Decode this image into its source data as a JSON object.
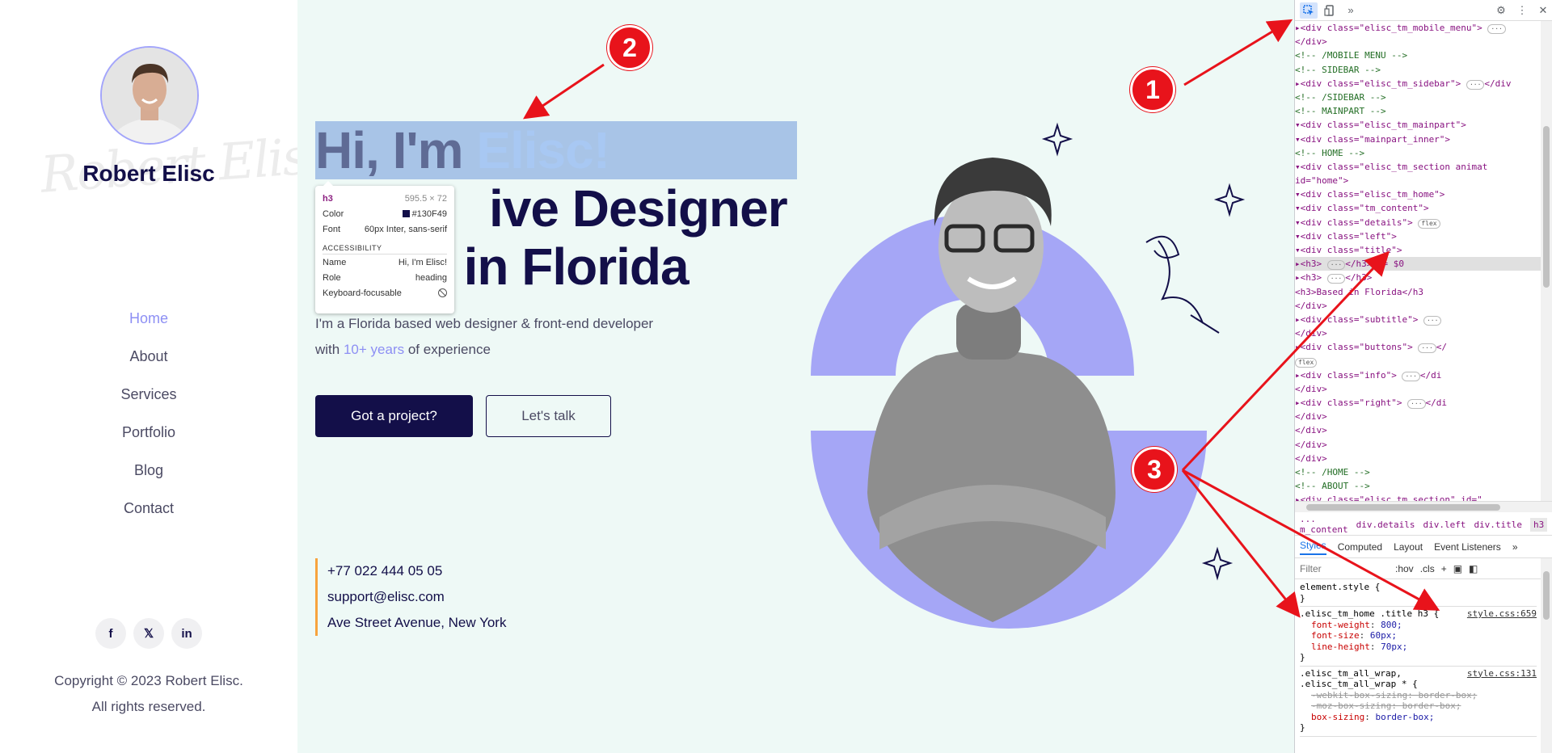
{
  "sidebar": {
    "name": "Robert Elisc",
    "nav": [
      {
        "label": "Home",
        "active": true
      },
      {
        "label": "About",
        "active": false
      },
      {
        "label": "Services",
        "active": false
      },
      {
        "label": "Portfolio",
        "active": false
      },
      {
        "label": "Blog",
        "active": false
      },
      {
        "label": "Contact",
        "active": false
      }
    ],
    "socials": [
      {
        "label": "f",
        "icon": "facebook-icon"
      },
      {
        "label": "𝕏",
        "icon": "twitter-icon"
      },
      {
        "label": "in",
        "icon": "linkedin-icon"
      }
    ],
    "copyright_line1": "Copyright © 2023 Robert Elisc.",
    "copyright_line2": "All rights reserved."
  },
  "hero": {
    "title_line1_prefix": "Hi, I'm ",
    "title_line1_accent": "Elisc!",
    "title_line2": "ive Designer",
    "title_line3": "l in Florida",
    "subtitle_line1": "I'm a Florida based web designer & front-end developer",
    "subtitle_prefix": "with ",
    "subtitle_highlight": "10+ years",
    "subtitle_suffix": " of experience",
    "primary_button": "Got a project?",
    "secondary_button": "Let's talk",
    "phone": "+77 022 444 05 05",
    "email": "support@elisc.com",
    "address": "Ave Street Avenue, New York"
  },
  "tooltip": {
    "tag": "h3",
    "size": "595.5 × 72",
    "color_label": "Color",
    "color_value": "#130F49",
    "font_label": "Font",
    "font_value": "60px Inter, sans-serif",
    "section": "ACCESSIBILITY",
    "name_label": "Name",
    "name_value": "Hi, I'm Elisc!",
    "role_label": "Role",
    "role_value": "heading",
    "kbd_label": "Keyboard-focusable"
  },
  "devtools": {
    "more_tabs": "»",
    "breadcrumbs": [
      "... m_content",
      "div.details",
      "div.left",
      "div.title",
      "h3",
      "..."
    ],
    "tabs": [
      "Styles",
      "Computed",
      "Layout",
      "Event Listeners",
      "»"
    ],
    "filter_placeholder": "Filter",
    "hov_label": ":hov",
    "cls_label": ".cls",
    "add_rule_label": "+",
    "tree": [
      {
        "t": "▸<div class=\"elisc_tm_mobile_menu\">",
        "badge": "···"
      },
      {
        "t": " </div>"
      },
      {
        "t": " <!-- /MOBILE MENU -->",
        "c": true
      },
      {
        "t": " <!-- SIDEBAR -->",
        "c": true
      },
      {
        "t": "▸<div class=\"elisc_tm_sidebar\">",
        "badge": "···",
        "tail": "</div"
      },
      {
        "t": " <!-- /SIDEBAR -->",
        "c": true
      },
      {
        "t": " <!-- MAINPART -->",
        "c": true
      },
      {
        "t": "▾<div class=\"elisc_tm_mainpart\">"
      },
      {
        "t": "  ▾<div class=\"mainpart_inner\">"
      },
      {
        "t": "     <!-- HOME -->",
        "c": true
      },
      {
        "t": "    ▾<div class=\"elisc_tm_section animat"
      },
      {
        "t": "     id=\"home\">"
      },
      {
        "t": "      ▾<div class=\"elisc_tm_home\">"
      },
      {
        "t": "        ▾<div class=\"tm_content\">"
      },
      {
        "t": "          ▾<div class=\"details\">",
        "badge": "flex"
      },
      {
        "t": "            ▾<div class=\"left\">"
      },
      {
        "t": "              ▾<div class=\"title\">"
      },
      {
        "t": "                ▸<h3>",
        "badge": "···",
        "tail": "</h3> == $0",
        "sel": true
      },
      {
        "t": "                ▸<h3>",
        "badge": "···",
        "tail": "</h3>"
      },
      {
        "t": "                 <h3>Based in Florida</h3"
      },
      {
        "t": "               </div>"
      },
      {
        "t": "              ▸<div class=\"subtitle\">",
        "badge": "···"
      },
      {
        "t": "               </div>"
      },
      {
        "t": "              ▸<div class=\"buttons\">",
        "badge": "···",
        "tail": "</"
      },
      {
        "t": "                ",
        "badge": "flex"
      },
      {
        "t": "              ▸<div class=\"info\">",
        "badge": "···",
        "tail": "</di"
      },
      {
        "t": "             </div>"
      },
      {
        "t": "            ▸<div class=\"right\">",
        "badge": "···",
        "tail": "</di"
      },
      {
        "t": "           </div>"
      },
      {
        "t": "         </div>"
      },
      {
        "t": "       </div>"
      },
      {
        "t": "     </div>"
      },
      {
        "t": "     <!-- /HOME -->",
        "c": true
      },
      {
        "t": "     <!-- ABOUT -->",
        "c": true
      },
      {
        "t": "    ▸<div class=\"elisc_tm_section\" id=\""
      }
    ],
    "rules": [
      {
        "selector": "element.style {",
        "source": "",
        "props": [],
        "close": "}"
      },
      {
        "selector": ".elisc_tm_home .title h3 {",
        "source": "style.css:659",
        "props": [
          {
            "name": "font-weight",
            "value": "800;"
          },
          {
            "name": "font-size",
            "value": "60px;"
          },
          {
            "name": "line-height",
            "value": "70px;"
          }
        ],
        "close": "}"
      },
      {
        "selector": ".elisc_tm_all_wrap,",
        "source": "style.css:131",
        "selector2": ".elisc_tm_all_wrap * {",
        "props": [
          {
            "name": "-webkit-box-sizing",
            "value": "border-box;",
            "strike": true
          },
          {
            "name": "-moz-box-sizing",
            "value": "border-box;",
            "strike": true
          },
          {
            "name": "box-sizing",
            "value": "border-box;"
          }
        ],
        "close": "}"
      }
    ]
  },
  "annotations": [
    "1",
    "2",
    "3"
  ],
  "colors": {
    "navy": "#130F49",
    "accent": "#8D8FF4",
    "purple_shape": "#A5A6F6",
    "annotation_red": "#E8131B",
    "info_border": "#F7A33D"
  }
}
